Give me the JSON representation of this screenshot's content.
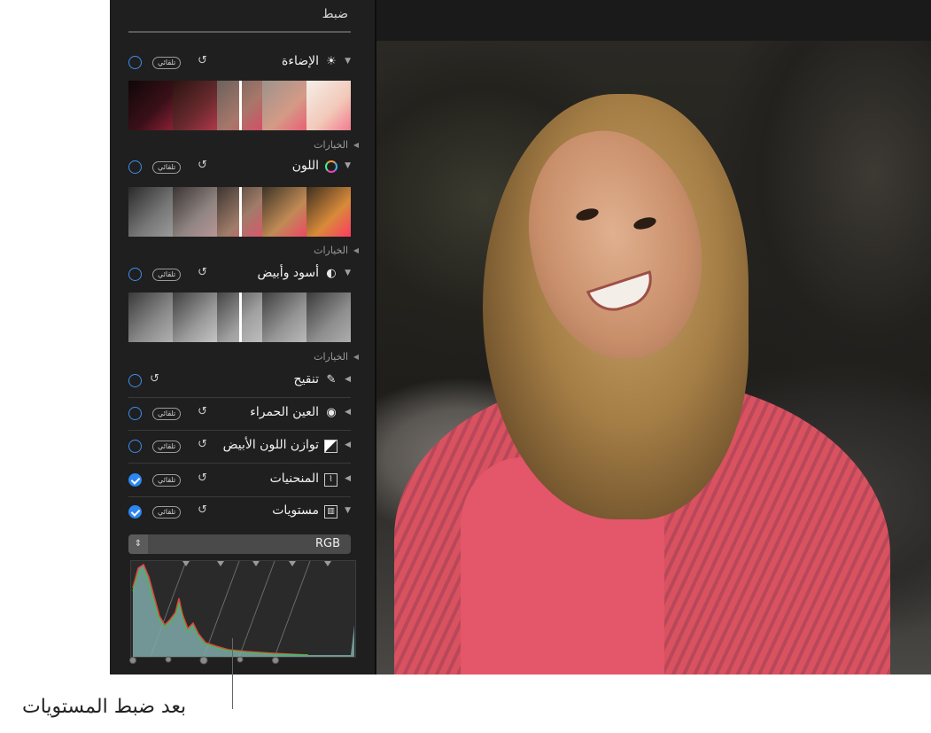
{
  "panel": {
    "title": "ضبط",
    "options_label": "الخيارات",
    "auto_label": "تلقائي",
    "sections": [
      {
        "label": "الإضاءة",
        "icon": "sun-icon",
        "checked": false,
        "auto": true,
        "expanded": true
      },
      {
        "label": "اللون",
        "icon": "color-wheel-icon",
        "checked": false,
        "auto": true,
        "expanded": true
      },
      {
        "label": "أسود وأبيض",
        "icon": "half-circle-icon",
        "checked": false,
        "auto": true,
        "expanded": true
      },
      {
        "label": "تنقيح",
        "icon": "bandage-icon",
        "checked": false,
        "auto": false,
        "expanded": false
      },
      {
        "label": "العين الحمراء",
        "icon": "red-eye-icon",
        "checked": false,
        "auto": true,
        "expanded": false
      },
      {
        "label": "توازن اللون الأبيض",
        "icon": "white-balance-icon",
        "checked": false,
        "auto": true,
        "expanded": false
      },
      {
        "label": "المنحنيات",
        "icon": "curves-icon",
        "checked": true,
        "auto": true,
        "expanded": false
      },
      {
        "label": "مستويات",
        "icon": "levels-icon",
        "checked": true,
        "auto": true,
        "expanded": true
      }
    ],
    "levels_channel": "RGB"
  },
  "callout": {
    "text": "بعد ضبط المستويات"
  },
  "colors": {
    "accent": "#2e86f0",
    "panel_bg": "#1f1f1f",
    "histogram_red": "#e0453c",
    "histogram_green": "#3fbf55",
    "histogram_fill": "#7fa9a8"
  }
}
